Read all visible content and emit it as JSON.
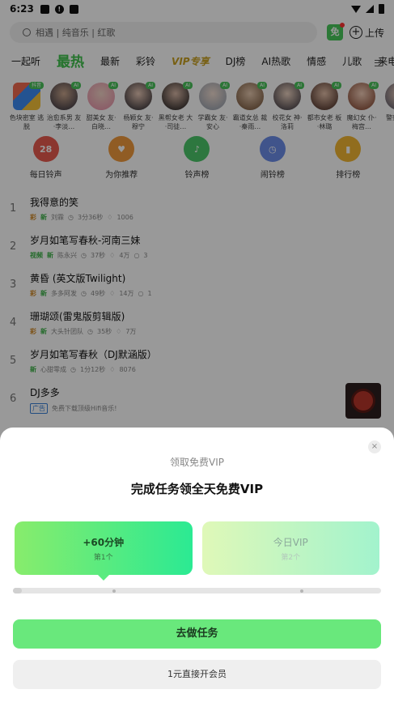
{
  "status_bar": {
    "time": "6:23"
  },
  "search": {
    "placeholder": "相遇 | 纯音乐 | 红歌"
  },
  "header": {
    "free_label": "免",
    "upload_label": "上传"
  },
  "tabs": [
    {
      "label": "一起听"
    },
    {
      "label": "最热"
    },
    {
      "label": "最新"
    },
    {
      "label": "彩铃"
    },
    {
      "label": "VIP专享"
    },
    {
      "label": "DJ榜"
    },
    {
      "label": "AI热歌"
    },
    {
      "label": "情感"
    },
    {
      "label": "儿歌"
    },
    {
      "label": "来电"
    }
  ],
  "avatars": [
    {
      "caption": "色块密室 逃脱",
      "badge": "抖音"
    },
    {
      "caption": "治愈系男 友·李淡…",
      "badge": "AI"
    },
    {
      "caption": "甜美女 友·白晓…",
      "badge": "AI"
    },
    {
      "caption": "杨颖女 友·穆宁",
      "badge": "AI"
    },
    {
      "caption": "黑帮女老 大·司徒…",
      "badge": "AI"
    },
    {
      "caption": "学霸女 友·安心",
      "badge": "AI"
    },
    {
      "caption": "霸道女总 裁·秦雨…",
      "badge": "AI"
    },
    {
      "caption": "校花女 神·洛莉",
      "badge": "AI"
    },
    {
      "caption": "都市女老 板·林璐",
      "badge": "AI"
    },
    {
      "caption": "魔幻女 仆·梅宫…",
      "badge": "AI"
    },
    {
      "caption": "警察女…",
      "badge": ""
    }
  ],
  "quick_entries": [
    {
      "label": "每日铃声",
      "glyph": "28",
      "color": "#e85a4f"
    },
    {
      "label": "为你推荐",
      "glyph": "♥",
      "color": "#f09a3c"
    },
    {
      "label": "铃声榜",
      "glyph": "♪",
      "color": "#4cc76a"
    },
    {
      "label": "闹铃榜",
      "glyph": "◷",
      "color": "#6b8de8"
    },
    {
      "label": "排行榜",
      "glyph": "▮",
      "color": "#f2b632"
    }
  ],
  "songs": [
    {
      "rank": "1",
      "title": "我得意的笑",
      "tag1": "彩",
      "tag2": "新",
      "artist": "刘霖",
      "duration": "3分36秒",
      "likes": "1006",
      "comments": ""
    },
    {
      "rank": "2",
      "title": "岁月如笔写春秋-河南三妹",
      "tag1": "视频",
      "tag2": "新",
      "artist": "陈永兴",
      "duration": "37秒",
      "likes": "4万",
      "comments": "3"
    },
    {
      "rank": "3",
      "title": "黄昏 (英文版Twilight)",
      "tag1": "彩",
      "tag2": "新",
      "artist": "多多阿发",
      "duration": "49秒",
      "likes": "14万",
      "comments": "1"
    },
    {
      "rank": "4",
      "title": "珊瑚颂(雷鬼版剪辑版)",
      "tag1": "彩",
      "tag2": "新",
      "artist": "大头针团队",
      "duration": "35秒",
      "likes": "7万",
      "comments": ""
    },
    {
      "rank": "5",
      "title": "岁月如笔写春秋（DJ默涵版）",
      "tag1": "",
      "tag2": "新",
      "artist": "心甜零成",
      "duration": "1分12秒",
      "likes": "8076",
      "comments": ""
    },
    {
      "rank": "6",
      "title": "DJ多多",
      "tag1": "广告",
      "tag2": "",
      "artist": "免费下载顶级Hifi音乐!",
      "duration": "",
      "likes": "",
      "comments": ""
    }
  ],
  "sheet": {
    "subtitle": "领取免费VIP",
    "title": "完成任务领全天免费VIP",
    "close_glyph": "×",
    "cards": [
      {
        "main": "+60分钟",
        "sub": "第1个"
      },
      {
        "main": "今日VIP",
        "sub": "第2个"
      }
    ],
    "progress_fraction": 0.0,
    "primary_button": "去做任务",
    "secondary_button": "1元直接开会员"
  }
}
